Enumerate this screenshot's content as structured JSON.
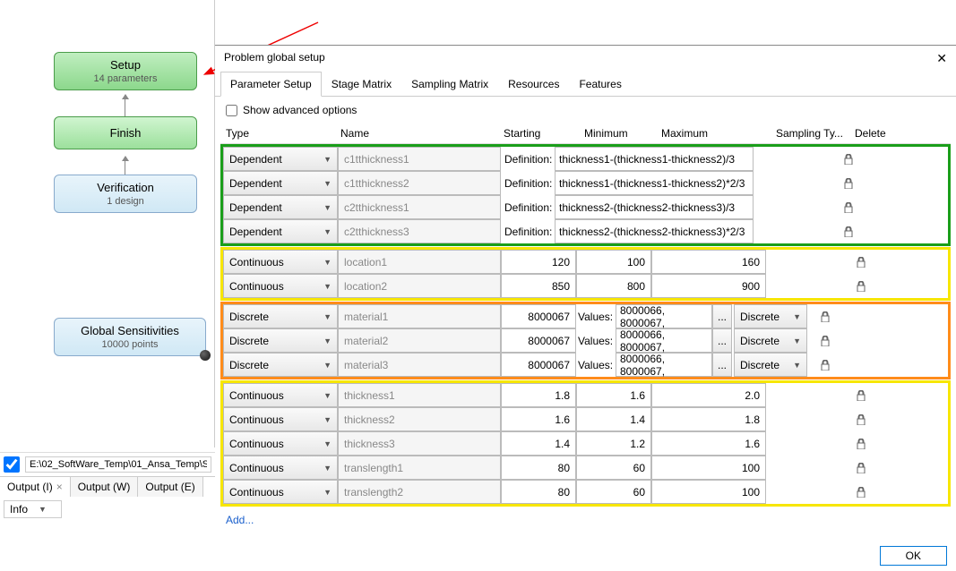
{
  "left_panel": {
    "setup": {
      "title": "Setup",
      "sub": "14 parameters"
    },
    "finish": {
      "title": "Finish"
    },
    "verification": {
      "title": "Verification",
      "sub": "1 design"
    },
    "global": {
      "title": "Global Sensitivities",
      "sub": "10000 points"
    },
    "path": "E:\\02_SoftWare_Temp\\01_Ansa_Temp\\S",
    "tabs": [
      "Output (I)",
      "Output (W)",
      "Output (E)"
    ],
    "info_label": "Info"
  },
  "dialog": {
    "title": "Problem global setup",
    "tabs": [
      "Parameter Setup",
      "Stage Matrix",
      "Sampling Matrix",
      "Resources",
      "Features"
    ],
    "advanced": "Show advanced options",
    "headers": {
      "type": "Type",
      "name": "Name",
      "starting": "Starting",
      "min": "Minimum",
      "max": "Maximum",
      "samp": "Sampling Ty...",
      "del": "Delete"
    },
    "add": "Add...",
    "ok": "OK",
    "def_label": "Definition:",
    "val_label": "Values:",
    "types": {
      "dep": "Dependent",
      "cont": "Continuous",
      "disc": "Discrete"
    },
    "samp_disc": "Discrete",
    "dep_rows": [
      {
        "name": "c1tthickness1",
        "def": "thickness1-(thickness1-thickness2)/3"
      },
      {
        "name": "c1tthickness2",
        "def": "thickness1-(thickness1-thickness2)*2/3"
      },
      {
        "name": "c2tthickness1",
        "def": "thickness2-(thickness2-thickness3)/3"
      },
      {
        "name": "c2tthickness3",
        "def": "thickness2-(thickness2-thickness3)*2/3"
      }
    ],
    "cont1": [
      {
        "name": "location1",
        "start": "120",
        "min": "100",
        "max": "160"
      },
      {
        "name": "location2",
        "start": "850",
        "min": "800",
        "max": "900"
      }
    ],
    "disc": [
      {
        "name": "material1",
        "start": "8000067",
        "vals": "8000066, 8000067,"
      },
      {
        "name": "material2",
        "start": "8000067",
        "vals": "8000066, 8000067,"
      },
      {
        "name": "material3",
        "start": "8000067",
        "vals": "8000066, 8000067,"
      }
    ],
    "cont2": [
      {
        "name": "thickness1",
        "start": "1.8",
        "min": "1.6",
        "max": "2.0"
      },
      {
        "name": "thickness2",
        "start": "1.6",
        "min": "1.4",
        "max": "1.8"
      },
      {
        "name": "thickness3",
        "start": "1.4",
        "min": "1.2",
        "max": "1.6"
      },
      {
        "name": "translength1",
        "start": "80",
        "min": "60",
        "max": "100"
      },
      {
        "name": "translength2",
        "start": "80",
        "min": "60",
        "max": "100"
      }
    ]
  }
}
